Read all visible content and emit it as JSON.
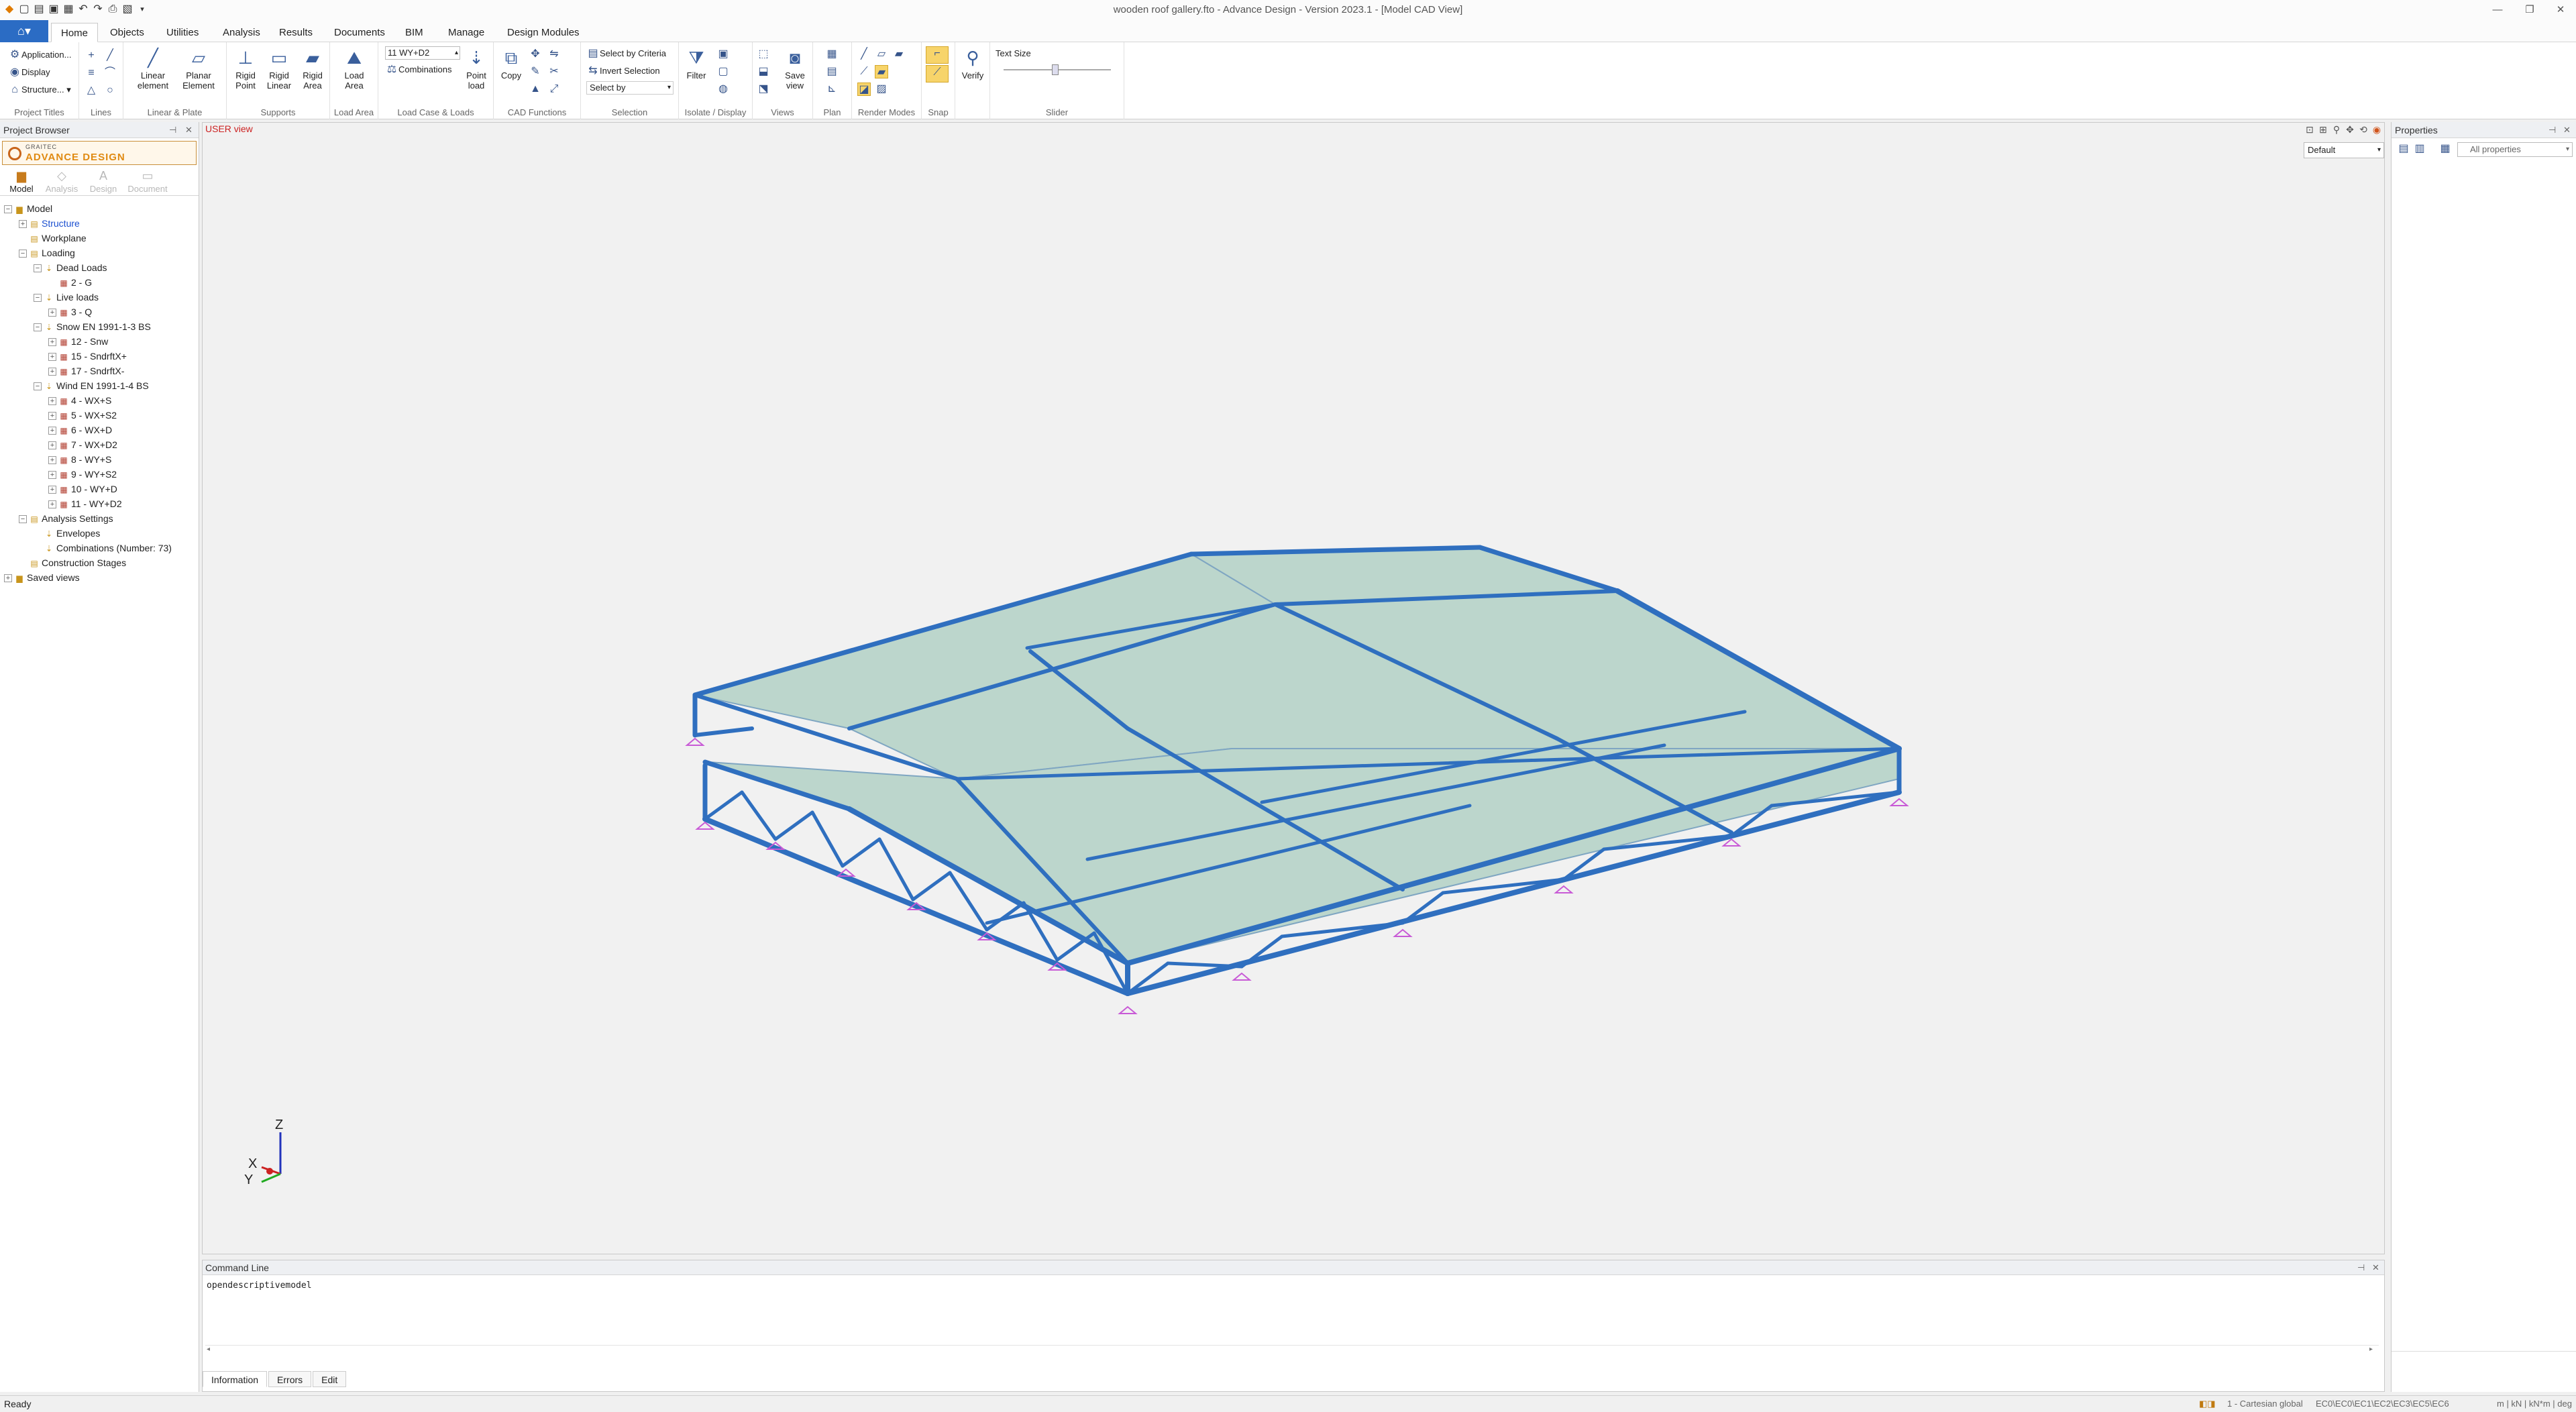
{
  "window": {
    "title": "wooden roof gallery.fto - Advance Design - Version 2023.1 - [Model CAD View]"
  },
  "ribbon_tabs": [
    "Home",
    "Objects",
    "Utilities",
    "Analysis",
    "Results",
    "Documents",
    "BIM",
    "Manage",
    "Design Modules"
  ],
  "active_tab": "Home",
  "ribbon": {
    "project_titles": {
      "label": "Project Titles",
      "items": [
        "Application...",
        "Display",
        "Structure..."
      ]
    },
    "lines": {
      "label": "Lines"
    },
    "linear_plate": {
      "label": "Linear & Plate",
      "linear": "Linear element",
      "planar": "Planar Element"
    },
    "supports": {
      "label": "Supports",
      "rigid_point": "Rigid Point",
      "rigid_linear": "Rigid Linear",
      "rigid_area": "Rigid Area"
    },
    "load_area": {
      "label": "Load Area",
      "btn": "Load Area"
    },
    "load_case": {
      "label": "Load Case & Loads",
      "selected_case": "11 WY+D2",
      "combinations": "Combinations",
      "point_load": "Point load"
    },
    "cad": {
      "label": "CAD Functions",
      "copy": "Copy"
    },
    "selection": {
      "label": "Selection",
      "by_criteria": "Select by Criteria",
      "invert": "Invert Selection",
      "select_by": "Select by"
    },
    "isolate": {
      "label": "Isolate / Display",
      "filter": "Filter"
    },
    "views": {
      "label": "Views",
      "save_view": "Save view"
    },
    "plan": {
      "label": "Plan"
    },
    "render": {
      "label": "Render Modes"
    },
    "snap": {
      "label": "Snap"
    },
    "verify": {
      "label": "",
      "btn": "Verify"
    },
    "slider": {
      "label": "Slider",
      "text_size": "Text Size"
    }
  },
  "project_browser": {
    "title": "Project Browser",
    "brand_top": "GRAITEC",
    "brand": "ADVANCE DESIGN",
    "modes": [
      "Model",
      "Analysis",
      "Design",
      "Document"
    ],
    "tree": [
      {
        "label": "Model",
        "level": 0,
        "exp": "−"
      },
      {
        "label": "Structure",
        "level": 1,
        "exp": "+",
        "sel": true
      },
      {
        "label": "Workplane",
        "level": 1,
        "exp": ""
      },
      {
        "label": "Loading",
        "level": 1,
        "exp": "−"
      },
      {
        "label": "Dead Loads",
        "level": 2,
        "exp": "−"
      },
      {
        "label": "2 - G",
        "level": 3,
        "exp": ""
      },
      {
        "label": "Live loads",
        "level": 2,
        "exp": "−"
      },
      {
        "label": "3 - Q",
        "level": 3,
        "exp": "+"
      },
      {
        "label": "Snow EN 1991-1-3 BS",
        "level": 2,
        "exp": "−"
      },
      {
        "label": "12 - Snw",
        "level": 3,
        "exp": "+"
      },
      {
        "label": "15 - SndrftX+",
        "level": 3,
        "exp": "+"
      },
      {
        "label": "17 - SndrftX-",
        "level": 3,
        "exp": "+"
      },
      {
        "label": "Wind EN 1991-1-4 BS",
        "level": 2,
        "exp": "−"
      },
      {
        "label": "4 - WX+S",
        "level": 3,
        "exp": "+"
      },
      {
        "label": "5 - WX+S2",
        "level": 3,
        "exp": "+"
      },
      {
        "label": "6 - WX+D",
        "level": 3,
        "exp": "+"
      },
      {
        "label": "7 - WX+D2",
        "level": 3,
        "exp": "+"
      },
      {
        "label": "8 - WY+S",
        "level": 3,
        "exp": "+"
      },
      {
        "label": "9 - WY+S2",
        "level": 3,
        "exp": "+"
      },
      {
        "label": "10 - WY+D",
        "level": 3,
        "exp": "+"
      },
      {
        "label": "11 - WY+D2",
        "level": 3,
        "exp": "+"
      },
      {
        "label": "Analysis Settings",
        "level": 1,
        "exp": "−"
      },
      {
        "label": "Envelopes",
        "level": 2,
        "exp": ""
      },
      {
        "label": "Combinations (Number: 73)",
        "level": 2,
        "exp": ""
      },
      {
        "label": "Construction Stages",
        "level": 1,
        "exp": ""
      },
      {
        "label": "Saved views",
        "level": 0,
        "exp": "+"
      }
    ]
  },
  "viewport": {
    "label": "USER view",
    "view_select": "Default",
    "axes": {
      "z": "Z",
      "x": "X",
      "y": "Y"
    }
  },
  "properties": {
    "title": "Properties",
    "filter": "All properties"
  },
  "command": {
    "title": "Command Line",
    "text": "opendescriptivemodel",
    "tabs": [
      "Information",
      "Errors",
      "Edit"
    ]
  },
  "status": {
    "left": "Ready",
    "coord": "1 - Cartesian global",
    "codes": "EC0\\EC0\\EC1\\EC2\\EC3\\EC5\\EC6",
    "units": "m | kN | kN*m | deg"
  },
  "colors": {
    "accent": "#2b6cc4",
    "beam": "#2f6fbf",
    "plate": "#bcd6cc",
    "support": "#c85ad6"
  }
}
